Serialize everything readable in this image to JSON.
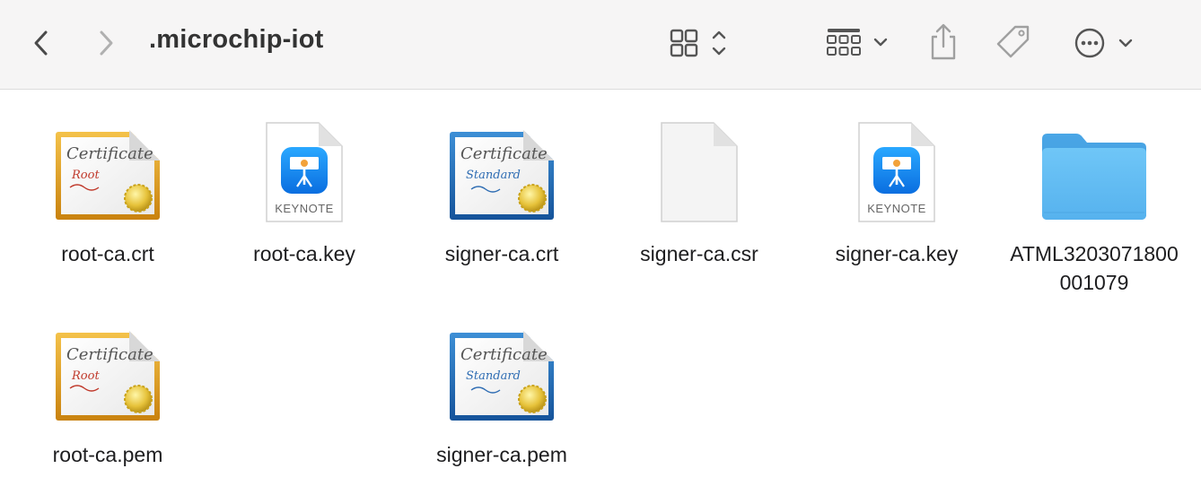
{
  "window": {
    "title": ".microchip-iot"
  },
  "toolbar": {
    "back_icon": "chevron-left-icon",
    "forward_icon": "chevron-right-icon",
    "view_icon": "icon-grid-view-icon",
    "group_icon": "group-by-icon",
    "share_icon": "share-icon",
    "tag_icon": "tag-icon",
    "more_icon": "ellipsis-circle-icon"
  },
  "files": [
    {
      "name": "root-ca.crt",
      "icon": "root-certificate-icon"
    },
    {
      "name": "root-ca.key",
      "icon": "keynote-document-icon",
      "badge": "KEYNOTE"
    },
    {
      "name": "signer-ca.crt",
      "icon": "standard-certificate-icon"
    },
    {
      "name": "signer-ca.csr",
      "icon": "blank-document-icon"
    },
    {
      "name": "signer-ca.key",
      "icon": "keynote-document-icon",
      "badge": "KEYNOTE"
    },
    {
      "name": "ATML3203071800001079",
      "icon": "folder-icon"
    },
    {
      "name": "root-ca.pem",
      "icon": "root-certificate-icon"
    },
    {
      "name": "signer-ca.pem",
      "icon": "standard-certificate-icon"
    }
  ],
  "cert_text": {
    "heading": "Certificate",
    "root": "Root",
    "standard": "Standard"
  },
  "colors": {
    "toolbar_bg": "#f6f5f5",
    "root_frame": "#e5a21f",
    "standard_frame": "#1f6fb8",
    "folder": "#5ab4ec",
    "keynote": "#1a8cf0"
  }
}
